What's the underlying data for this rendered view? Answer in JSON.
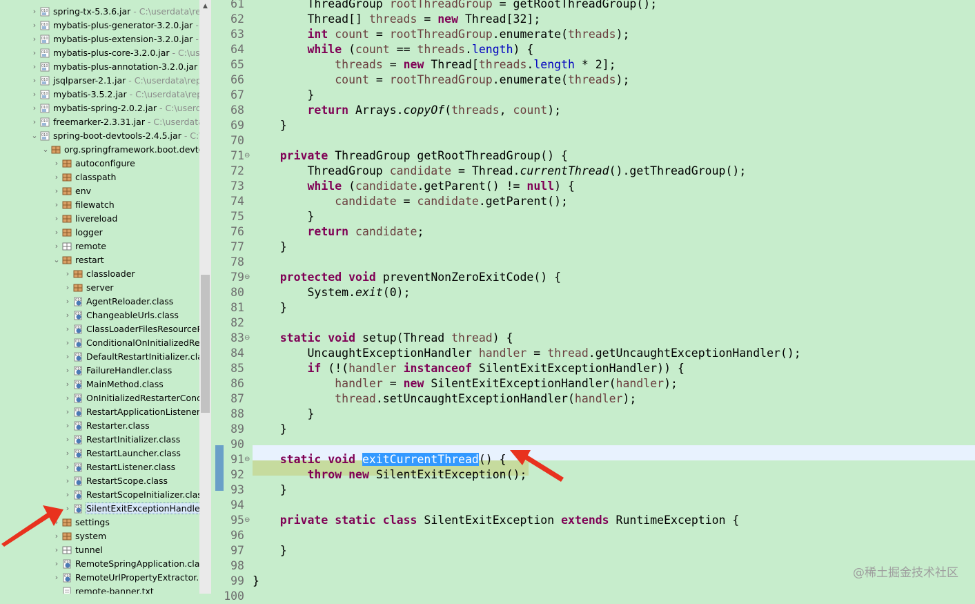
{
  "tree": [
    {
      "indent": 0,
      "arrow": "right",
      "icon": "jar-icon",
      "label": "spring-tx-5.3.6.jar",
      "path": " - C:\\userdata\\repo"
    },
    {
      "indent": 0,
      "arrow": "right",
      "icon": "jar-icon",
      "label": "mybatis-plus-generator-3.2.0.jar",
      "path": " - C:"
    },
    {
      "indent": 0,
      "arrow": "right",
      "icon": "jar-icon",
      "label": "mybatis-plus-extension-3.2.0.jar",
      "path": " - C:\\"
    },
    {
      "indent": 0,
      "arrow": "right",
      "icon": "jar-icon",
      "label": "mybatis-plus-core-3.2.0.jar",
      "path": " - C:\\userda"
    },
    {
      "indent": 0,
      "arrow": "right",
      "icon": "jar-icon",
      "label": "mybatis-plus-annotation-3.2.0.jar",
      "path": " - C"
    },
    {
      "indent": 0,
      "arrow": "right",
      "icon": "jar-icon",
      "label": "jsqlparser-2.1.jar",
      "path": " - C:\\userdata\\repo"
    },
    {
      "indent": 0,
      "arrow": "right",
      "icon": "jar-icon",
      "label": "mybatis-3.5.2.jar",
      "path": " - C:\\userdata\\repos"
    },
    {
      "indent": 0,
      "arrow": "right",
      "icon": "jar-icon",
      "label": "mybatis-spring-2.0.2.jar",
      "path": " - C:\\userdata"
    },
    {
      "indent": 0,
      "arrow": "right",
      "icon": "jar-icon",
      "label": "freemarker-2.3.31.jar",
      "path": " - C:\\userdata\\r"
    },
    {
      "indent": 0,
      "arrow": "down",
      "icon": "jar-icon",
      "label": "spring-boot-devtools-2.4.5.jar",
      "path": " - C:\\u"
    },
    {
      "indent": 1,
      "arrow": "down",
      "icon": "package-icon",
      "label": "org.springframework.boot.devtoo",
      "path": ""
    },
    {
      "indent": 2,
      "arrow": "right",
      "icon": "package-icon",
      "label": "autoconfigure",
      "path": ""
    },
    {
      "indent": 2,
      "arrow": "right",
      "icon": "package-icon",
      "label": "classpath",
      "path": ""
    },
    {
      "indent": 2,
      "arrow": "right",
      "icon": "package-icon",
      "label": "env",
      "path": ""
    },
    {
      "indent": 2,
      "arrow": "right",
      "icon": "package-icon",
      "label": "filewatch",
      "path": ""
    },
    {
      "indent": 2,
      "arrow": "right",
      "icon": "package-icon",
      "label": "livereload",
      "path": ""
    },
    {
      "indent": 2,
      "arrow": "right",
      "icon": "package-icon",
      "label": "logger",
      "path": ""
    },
    {
      "indent": 2,
      "arrow": "right",
      "icon": "package-empty-icon",
      "label": "remote",
      "path": ""
    },
    {
      "indent": 2,
      "arrow": "down",
      "icon": "package-icon",
      "label": "restart",
      "path": ""
    },
    {
      "indent": 3,
      "arrow": "right",
      "icon": "package-icon",
      "label": "classloader",
      "path": ""
    },
    {
      "indent": 3,
      "arrow": "right",
      "icon": "package-icon",
      "label": "server",
      "path": ""
    },
    {
      "indent": 3,
      "arrow": "right",
      "icon": "class-file-icon",
      "label": "AgentReloader.class",
      "path": ""
    },
    {
      "indent": 3,
      "arrow": "right",
      "icon": "class-file-icon",
      "label": "ChangeableUrls.class",
      "path": ""
    },
    {
      "indent": 3,
      "arrow": "right",
      "icon": "class-file-icon",
      "label": "ClassLoaderFilesResourcePa",
      "path": ""
    },
    {
      "indent": 3,
      "arrow": "right",
      "icon": "class-file-icon",
      "label": "ConditionalOnInitializedRest",
      "path": ""
    },
    {
      "indent": 3,
      "arrow": "right",
      "icon": "class-file-icon",
      "label": "DefaultRestartInitializer.class",
      "path": ""
    },
    {
      "indent": 3,
      "arrow": "right",
      "icon": "class-file-icon",
      "label": "FailureHandler.class",
      "path": ""
    },
    {
      "indent": 3,
      "arrow": "right",
      "icon": "class-file-icon",
      "label": "MainMethod.class",
      "path": ""
    },
    {
      "indent": 3,
      "arrow": "right",
      "icon": "class-file-icon",
      "label": "OnInitializedRestarterCondit",
      "path": ""
    },
    {
      "indent": 3,
      "arrow": "right",
      "icon": "class-file-icon",
      "label": "RestartApplicationListener.cl",
      "path": ""
    },
    {
      "indent": 3,
      "arrow": "right",
      "icon": "class-file-icon",
      "label": "Restarter.class",
      "path": ""
    },
    {
      "indent": 3,
      "arrow": "right",
      "icon": "class-file-icon",
      "label": "RestartInitializer.class",
      "path": ""
    },
    {
      "indent": 3,
      "arrow": "right",
      "icon": "class-file-icon",
      "label": "RestartLauncher.class",
      "path": ""
    },
    {
      "indent": 3,
      "arrow": "right",
      "icon": "class-file-icon",
      "label": "RestartListener.class",
      "path": ""
    },
    {
      "indent": 3,
      "arrow": "right",
      "icon": "class-file-icon",
      "label": "RestartScope.class",
      "path": ""
    },
    {
      "indent": 3,
      "arrow": "right",
      "icon": "class-file-icon",
      "label": "RestartScopeInitializer.class",
      "path": ""
    },
    {
      "indent": 3,
      "arrow": "right",
      "icon": "class-file-icon",
      "label": "SilentExitExceptionHandler.cl",
      "path": "",
      "selected": true
    },
    {
      "indent": 2,
      "arrow": "right",
      "icon": "package-icon",
      "label": "settings",
      "path": ""
    },
    {
      "indent": 2,
      "arrow": "right",
      "icon": "package-icon",
      "label": "system",
      "path": ""
    },
    {
      "indent": 2,
      "arrow": "right",
      "icon": "package-empty-icon",
      "label": "tunnel",
      "path": ""
    },
    {
      "indent": 2,
      "arrow": "right",
      "icon": "class-file-icon",
      "label": "RemoteSpringApplication.class",
      "path": ""
    },
    {
      "indent": 2,
      "arrow": "right",
      "icon": "class-file-icon",
      "label": "RemoteUrlPropertyExtractor.cla",
      "path": ""
    },
    {
      "indent": 2,
      "arrow": "none",
      "icon": "text-file-icon",
      "label": "remote-banner.txt",
      "path": ""
    }
  ],
  "code": [
    {
      "n": "61",
      "fold": false,
      "t": [
        [
          "",
          "        "
        ],
        [
          "",
          "ThreadGroup "
        ],
        [
          "fld",
          "rootThreadGroup"
        ],
        [
          "",
          " = getRootThreadGroup();"
        ]
      ]
    },
    {
      "n": "62",
      "fold": false,
      "t": [
        [
          "",
          "        Thread[] "
        ],
        [
          "fld",
          "threads"
        ],
        [
          "",
          " = "
        ],
        [
          "kw",
          "new"
        ],
        [
          "",
          " Thread[32];"
        ]
      ]
    },
    {
      "n": "63",
      "fold": false,
      "t": [
        [
          "",
          "        "
        ],
        [
          "kw",
          "int"
        ],
        [
          "",
          " "
        ],
        [
          "fld",
          "count"
        ],
        [
          "",
          " = "
        ],
        [
          "fld",
          "rootThreadGroup"
        ],
        [
          "",
          ".enumerate("
        ],
        [
          "fld",
          "threads"
        ],
        [
          "",
          ");"
        ]
      ]
    },
    {
      "n": "64",
      "fold": false,
      "t": [
        [
          "",
          "        "
        ],
        [
          "kw",
          "while"
        ],
        [
          "",
          " ("
        ],
        [
          "fld",
          "count"
        ],
        [
          "",
          " == "
        ],
        [
          "fld",
          "threads"
        ],
        [
          "",
          "."
        ],
        [
          "fd",
          "length"
        ],
        [
          "",
          ") {"
        ]
      ]
    },
    {
      "n": "65",
      "fold": false,
      "t": [
        [
          "",
          "            "
        ],
        [
          "fld",
          "threads"
        ],
        [
          "",
          " = "
        ],
        [
          "kw",
          "new"
        ],
        [
          "",
          " Thread["
        ],
        [
          "fld",
          "threads"
        ],
        [
          "",
          "."
        ],
        [
          "fd",
          "length"
        ],
        [
          "",
          " * 2];"
        ]
      ]
    },
    {
      "n": "66",
      "fold": false,
      "t": [
        [
          "",
          "            "
        ],
        [
          "fld",
          "count"
        ],
        [
          "",
          " = "
        ],
        [
          "fld",
          "rootThreadGroup"
        ],
        [
          "",
          ".enumerate("
        ],
        [
          "fld",
          "threads"
        ],
        [
          "",
          ");"
        ]
      ]
    },
    {
      "n": "67",
      "fold": false,
      "t": [
        [
          "",
          "        }"
        ]
      ]
    },
    {
      "n": "68",
      "fold": false,
      "t": [
        [
          "",
          "        "
        ],
        [
          "kw",
          "return"
        ],
        [
          "",
          " Arrays."
        ],
        [
          "it",
          "copyOf"
        ],
        [
          "",
          "("
        ],
        [
          "fld",
          "threads"
        ],
        [
          "",
          ", "
        ],
        [
          "fld",
          "count"
        ],
        [
          "",
          ");"
        ]
      ]
    },
    {
      "n": "69",
      "fold": false,
      "t": [
        [
          "",
          "    }"
        ]
      ]
    },
    {
      "n": "70",
      "fold": false,
      "t": []
    },
    {
      "n": "71",
      "fold": true,
      "t": [
        [
          "",
          "    "
        ],
        [
          "kw",
          "private"
        ],
        [
          "",
          " ThreadGroup getRootThreadGroup() {"
        ]
      ]
    },
    {
      "n": "72",
      "fold": false,
      "t": [
        [
          "",
          "        ThreadGroup "
        ],
        [
          "fld",
          "candidate"
        ],
        [
          "",
          " = Thread."
        ],
        [
          "it",
          "currentThread"
        ],
        [
          "",
          "().getThreadGroup();"
        ]
      ]
    },
    {
      "n": "73",
      "fold": false,
      "t": [
        [
          "",
          "        "
        ],
        [
          "kw",
          "while"
        ],
        [
          "",
          " ("
        ],
        [
          "fld",
          "candidate"
        ],
        [
          "",
          ".getParent() != "
        ],
        [
          "kw",
          "null"
        ],
        [
          "",
          ") {"
        ]
      ]
    },
    {
      "n": "74",
      "fold": false,
      "t": [
        [
          "",
          "            "
        ],
        [
          "fld",
          "candidate"
        ],
        [
          "",
          " = "
        ],
        [
          "fld",
          "candidate"
        ],
        [
          "",
          ".getParent();"
        ]
      ]
    },
    {
      "n": "75",
      "fold": false,
      "t": [
        [
          "",
          "        }"
        ]
      ]
    },
    {
      "n": "76",
      "fold": false,
      "t": [
        [
          "",
          "        "
        ],
        [
          "kw",
          "return"
        ],
        [
          "",
          " "
        ],
        [
          "fld",
          "candidate"
        ],
        [
          "",
          ";"
        ]
      ]
    },
    {
      "n": "77",
      "fold": false,
      "t": [
        [
          "",
          "    }"
        ]
      ]
    },
    {
      "n": "78",
      "fold": false,
      "t": []
    },
    {
      "n": "79",
      "fold": true,
      "t": [
        [
          "",
          "    "
        ],
        [
          "kw",
          "protected"
        ],
        [
          "",
          " "
        ],
        [
          "kw",
          "void"
        ],
        [
          "",
          " preventNonZeroExitCode() {"
        ]
      ]
    },
    {
      "n": "80",
      "fold": false,
      "t": [
        [
          "",
          "        System."
        ],
        [
          "it",
          "exit"
        ],
        [
          "",
          "(0);"
        ]
      ]
    },
    {
      "n": "81",
      "fold": false,
      "t": [
        [
          "",
          "    }"
        ]
      ]
    },
    {
      "n": "82",
      "fold": false,
      "t": []
    },
    {
      "n": "83",
      "fold": true,
      "t": [
        [
          "",
          "    "
        ],
        [
          "kw",
          "static"
        ],
        [
          "",
          " "
        ],
        [
          "kw",
          "void"
        ],
        [
          "",
          " setup(Thread "
        ],
        [
          "fld",
          "thread"
        ],
        [
          "",
          ") {"
        ]
      ]
    },
    {
      "n": "84",
      "fold": false,
      "t": [
        [
          "",
          "        UncaughtExceptionHandler "
        ],
        [
          "fld",
          "handler"
        ],
        [
          "",
          " = "
        ],
        [
          "fld",
          "thread"
        ],
        [
          "",
          ".getUncaughtExceptionHandler();"
        ]
      ]
    },
    {
      "n": "85",
      "fold": false,
      "t": [
        [
          "",
          "        "
        ],
        [
          "kw",
          "if"
        ],
        [
          "",
          " (!("
        ],
        [
          "fld",
          "handler"
        ],
        [
          "",
          " "
        ],
        [
          "kw",
          "instanceof"
        ],
        [
          "",
          " SilentExitExceptionHandler)) {"
        ]
      ]
    },
    {
      "n": "86",
      "fold": false,
      "t": [
        [
          "",
          "            "
        ],
        [
          "fld",
          "handler"
        ],
        [
          "",
          " = "
        ],
        [
          "kw",
          "new"
        ],
        [
          "",
          " SilentExitExceptionHandler("
        ],
        [
          "fld",
          "handler"
        ],
        [
          "",
          ");"
        ]
      ]
    },
    {
      "n": "87",
      "fold": false,
      "t": [
        [
          "",
          "            "
        ],
        [
          "fld",
          "thread"
        ],
        [
          "",
          ".setUncaughtExceptionHandler("
        ],
        [
          "fld",
          "handler"
        ],
        [
          "",
          ");"
        ]
      ]
    },
    {
      "n": "88",
      "fold": false,
      "t": [
        [
          "",
          "        }"
        ]
      ]
    },
    {
      "n": "89",
      "fold": false,
      "t": [
        [
          "",
          "    }"
        ]
      ]
    },
    {
      "n": "90",
      "fold": false,
      "t": []
    },
    {
      "n": "91",
      "fold": true,
      "t": [
        [
          "",
          "    "
        ],
        [
          "kw",
          "static"
        ],
        [
          "",
          " "
        ],
        [
          "kw",
          "void"
        ],
        [
          "",
          " "
        ],
        [
          "sel",
          "exitCurrentThread"
        ],
        [
          "",
          "() {"
        ]
      ]
    },
    {
      "n": "92",
      "fold": false,
      "t": [
        [
          "",
          "        "
        ],
        [
          "kw",
          "throw"
        ],
        [
          "",
          " "
        ],
        [
          "kw",
          "new"
        ],
        [
          "",
          " SilentExitException();"
        ]
      ]
    },
    {
      "n": "93",
      "fold": false,
      "t": [
        [
          "",
          "    }"
        ]
      ]
    },
    {
      "n": "94",
      "fold": false,
      "t": []
    },
    {
      "n": "95",
      "fold": true,
      "t": [
        [
          "",
          "    "
        ],
        [
          "kw",
          "private"
        ],
        [
          "",
          " "
        ],
        [
          "kw",
          "static"
        ],
        [
          "",
          " "
        ],
        [
          "kw",
          "class"
        ],
        [
          "",
          " SilentExitException "
        ],
        [
          "kw",
          "extends"
        ],
        [
          "",
          " RuntimeException {"
        ]
      ]
    },
    {
      "n": "96",
      "fold": false,
      "t": []
    },
    {
      "n": "97",
      "fold": false,
      "t": [
        [
          "",
          "    }"
        ]
      ]
    },
    {
      "n": "98",
      "fold": false,
      "t": []
    },
    {
      "n": "99",
      "fold": false,
      "t": [
        [
          "",
          "}"
        ]
      ]
    },
    {
      "n": "100",
      "fold": false,
      "t": []
    }
  ],
  "watermark": "@稀土掘金技术社区",
  "colors": {
    "editor_bg": "#c7edcc",
    "keyword": "#7f0055",
    "field": "#6a3e3e",
    "selection": "#3399ff",
    "arrow": "#e8321e"
  }
}
